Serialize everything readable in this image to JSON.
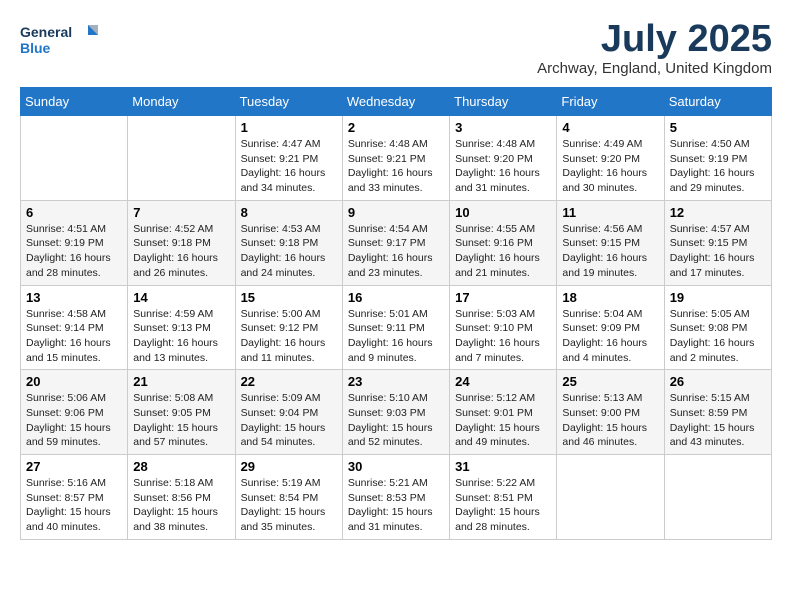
{
  "header": {
    "logo_line1": "General",
    "logo_line2": "Blue",
    "month_title": "July 2025",
    "subtitle": "Archway, England, United Kingdom"
  },
  "days_of_week": [
    "Sunday",
    "Monday",
    "Tuesday",
    "Wednesday",
    "Thursday",
    "Friday",
    "Saturday"
  ],
  "weeks": [
    [
      {
        "day": "",
        "sunrise": "",
        "sunset": "",
        "daylight": ""
      },
      {
        "day": "",
        "sunrise": "",
        "sunset": "",
        "daylight": ""
      },
      {
        "day": "1",
        "sunrise": "Sunrise: 4:47 AM",
        "sunset": "Sunset: 9:21 PM",
        "daylight": "Daylight: 16 hours and 34 minutes."
      },
      {
        "day": "2",
        "sunrise": "Sunrise: 4:48 AM",
        "sunset": "Sunset: 9:21 PM",
        "daylight": "Daylight: 16 hours and 33 minutes."
      },
      {
        "day": "3",
        "sunrise": "Sunrise: 4:48 AM",
        "sunset": "Sunset: 9:20 PM",
        "daylight": "Daylight: 16 hours and 31 minutes."
      },
      {
        "day": "4",
        "sunrise": "Sunrise: 4:49 AM",
        "sunset": "Sunset: 9:20 PM",
        "daylight": "Daylight: 16 hours and 30 minutes."
      },
      {
        "day": "5",
        "sunrise": "Sunrise: 4:50 AM",
        "sunset": "Sunset: 9:19 PM",
        "daylight": "Daylight: 16 hours and 29 minutes."
      }
    ],
    [
      {
        "day": "6",
        "sunrise": "Sunrise: 4:51 AM",
        "sunset": "Sunset: 9:19 PM",
        "daylight": "Daylight: 16 hours and 28 minutes."
      },
      {
        "day": "7",
        "sunrise": "Sunrise: 4:52 AM",
        "sunset": "Sunset: 9:18 PM",
        "daylight": "Daylight: 16 hours and 26 minutes."
      },
      {
        "day": "8",
        "sunrise": "Sunrise: 4:53 AM",
        "sunset": "Sunset: 9:18 PM",
        "daylight": "Daylight: 16 hours and 24 minutes."
      },
      {
        "day": "9",
        "sunrise": "Sunrise: 4:54 AM",
        "sunset": "Sunset: 9:17 PM",
        "daylight": "Daylight: 16 hours and 23 minutes."
      },
      {
        "day": "10",
        "sunrise": "Sunrise: 4:55 AM",
        "sunset": "Sunset: 9:16 PM",
        "daylight": "Daylight: 16 hours and 21 minutes."
      },
      {
        "day": "11",
        "sunrise": "Sunrise: 4:56 AM",
        "sunset": "Sunset: 9:15 PM",
        "daylight": "Daylight: 16 hours and 19 minutes."
      },
      {
        "day": "12",
        "sunrise": "Sunrise: 4:57 AM",
        "sunset": "Sunset: 9:15 PM",
        "daylight": "Daylight: 16 hours and 17 minutes."
      }
    ],
    [
      {
        "day": "13",
        "sunrise": "Sunrise: 4:58 AM",
        "sunset": "Sunset: 9:14 PM",
        "daylight": "Daylight: 16 hours and 15 minutes."
      },
      {
        "day": "14",
        "sunrise": "Sunrise: 4:59 AM",
        "sunset": "Sunset: 9:13 PM",
        "daylight": "Daylight: 16 hours and 13 minutes."
      },
      {
        "day": "15",
        "sunrise": "Sunrise: 5:00 AM",
        "sunset": "Sunset: 9:12 PM",
        "daylight": "Daylight: 16 hours and 11 minutes."
      },
      {
        "day": "16",
        "sunrise": "Sunrise: 5:01 AM",
        "sunset": "Sunset: 9:11 PM",
        "daylight": "Daylight: 16 hours and 9 minutes."
      },
      {
        "day": "17",
        "sunrise": "Sunrise: 5:03 AM",
        "sunset": "Sunset: 9:10 PM",
        "daylight": "Daylight: 16 hours and 7 minutes."
      },
      {
        "day": "18",
        "sunrise": "Sunrise: 5:04 AM",
        "sunset": "Sunset: 9:09 PM",
        "daylight": "Daylight: 16 hours and 4 minutes."
      },
      {
        "day": "19",
        "sunrise": "Sunrise: 5:05 AM",
        "sunset": "Sunset: 9:08 PM",
        "daylight": "Daylight: 16 hours and 2 minutes."
      }
    ],
    [
      {
        "day": "20",
        "sunrise": "Sunrise: 5:06 AM",
        "sunset": "Sunset: 9:06 PM",
        "daylight": "Daylight: 15 hours and 59 minutes."
      },
      {
        "day": "21",
        "sunrise": "Sunrise: 5:08 AM",
        "sunset": "Sunset: 9:05 PM",
        "daylight": "Daylight: 15 hours and 57 minutes."
      },
      {
        "day": "22",
        "sunrise": "Sunrise: 5:09 AM",
        "sunset": "Sunset: 9:04 PM",
        "daylight": "Daylight: 15 hours and 54 minutes."
      },
      {
        "day": "23",
        "sunrise": "Sunrise: 5:10 AM",
        "sunset": "Sunset: 9:03 PM",
        "daylight": "Daylight: 15 hours and 52 minutes."
      },
      {
        "day": "24",
        "sunrise": "Sunrise: 5:12 AM",
        "sunset": "Sunset: 9:01 PM",
        "daylight": "Daylight: 15 hours and 49 minutes."
      },
      {
        "day": "25",
        "sunrise": "Sunrise: 5:13 AM",
        "sunset": "Sunset: 9:00 PM",
        "daylight": "Daylight: 15 hours and 46 minutes."
      },
      {
        "day": "26",
        "sunrise": "Sunrise: 5:15 AM",
        "sunset": "Sunset: 8:59 PM",
        "daylight": "Daylight: 15 hours and 43 minutes."
      }
    ],
    [
      {
        "day": "27",
        "sunrise": "Sunrise: 5:16 AM",
        "sunset": "Sunset: 8:57 PM",
        "daylight": "Daylight: 15 hours and 40 minutes."
      },
      {
        "day": "28",
        "sunrise": "Sunrise: 5:18 AM",
        "sunset": "Sunset: 8:56 PM",
        "daylight": "Daylight: 15 hours and 38 minutes."
      },
      {
        "day": "29",
        "sunrise": "Sunrise: 5:19 AM",
        "sunset": "Sunset: 8:54 PM",
        "daylight": "Daylight: 15 hours and 35 minutes."
      },
      {
        "day": "30",
        "sunrise": "Sunrise: 5:21 AM",
        "sunset": "Sunset: 8:53 PM",
        "daylight": "Daylight: 15 hours and 31 minutes."
      },
      {
        "day": "31",
        "sunrise": "Sunrise: 5:22 AM",
        "sunset": "Sunset: 8:51 PM",
        "daylight": "Daylight: 15 hours and 28 minutes."
      },
      {
        "day": "",
        "sunrise": "",
        "sunset": "",
        "daylight": ""
      },
      {
        "day": "",
        "sunrise": "",
        "sunset": "",
        "daylight": ""
      }
    ]
  ]
}
